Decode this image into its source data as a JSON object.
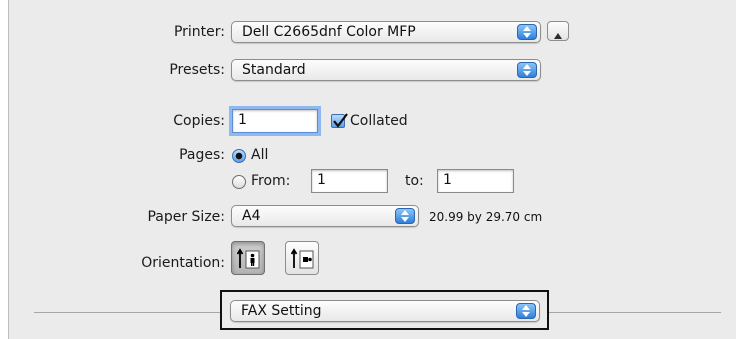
{
  "printer": {
    "label": "Printer:",
    "value": "Dell C2665dnf Color MFP"
  },
  "presets": {
    "label": "Presets:",
    "value": "Standard"
  },
  "copies": {
    "label": "Copies:",
    "value": "1",
    "collated_label": "Collated",
    "collated_checked": true
  },
  "pages": {
    "label": "Pages:",
    "all_label": "All",
    "from_label": "From:",
    "from_value": "1",
    "to_label": "to:",
    "to_value": "1",
    "selected": "All"
  },
  "paper_size": {
    "label": "Paper Size:",
    "value": "A4",
    "dimensions": "20.99 by 29.70 cm"
  },
  "orientation": {
    "label": "Orientation:",
    "options": [
      "portrait-icon",
      "landscape-icon"
    ],
    "selected": "portrait"
  },
  "section_menu": {
    "value": "FAX Setting"
  },
  "colors": {
    "accent": "#3a8be0",
    "panel": "#ebebeb"
  }
}
